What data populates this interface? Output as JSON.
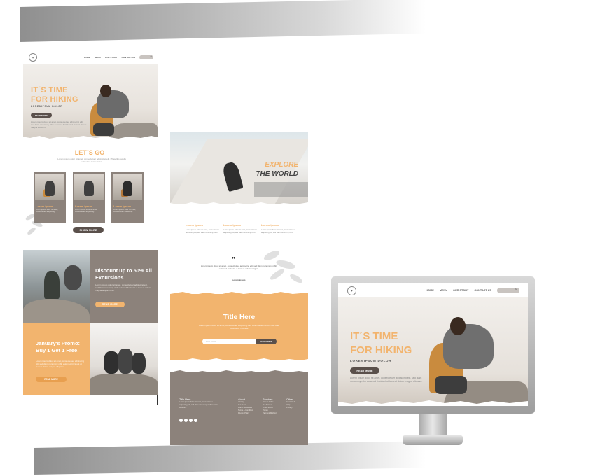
{
  "colors": {
    "accent": "#f2b46e",
    "taupe": "#8c827b",
    "dark": "#5a504b"
  },
  "nav": {
    "home": "HOME",
    "menu": "MENU",
    "story": "OUR STORY",
    "contact": "CONTACT US",
    "logo": "✦"
  },
  "hero": {
    "title_line1": "IT´S TIME",
    "title_line2": "FOR HIKING",
    "subtitle": "LOREMIPSUM DOLOR",
    "button": "READ MORE",
    "text": "Lorem ipsum dolor sit amet, consectetuer adipiscing elit, sed diam nonummy nibh euismod tincidunt ut laoreet dolore magna aliquam."
  },
  "lets_go": {
    "title": "LET´S GO",
    "desc": "Lorem ipsum dolor sit amet, consectetuer adipiscing elit. Phasellus iaculis velit vitae consectetur."
  },
  "cards": [
    {
      "title": "Lorem ipsum",
      "text": "Lorem ipsum dolor sit amet, consectetuer adipiscing."
    },
    {
      "title": "Lorem ipsum",
      "text": "Lorem ipsum dolor sit amet, consectetuer adipiscing."
    },
    {
      "title": "Lorem ipsum",
      "text": "Lorem ipsum dolor sit amet, consectetuer adipiscing."
    }
  ],
  "show_more": "SHOW MORE",
  "discount": {
    "title": "Discount up to 50% All Excursions",
    "text": "Lorem ipsum dolor sit amet, consectetuer adipiscing elit, sed diam nonummy nibh euismod tincidunt ut laoreet dolore magna aliquam erat.",
    "button": "READ MORE"
  },
  "promo": {
    "title": "January's Promo: Buy 1 Get 1 Free!",
    "text": "Lorem ipsum dolor sit amet, consectetuer adipiscing elit, sed diam nonummy nibh euismod tincidunt ut laoreet dolore magna aliquam.",
    "button": "READ MORE"
  },
  "explore": {
    "line1": "EXPLORE",
    "line2": "THE WORLD"
  },
  "columns": [
    {
      "title": "Lorem Ipsum",
      "text": "Lorem ipsum dolor sit amet, consectetuer adipiscing elit, sed diam nonummy nibh."
    },
    {
      "title": "Lorem Ipsum",
      "text": "Lorem ipsum dolor sit amet, consectetuer adipiscing elit, sed diam nonummy nibh."
    },
    {
      "title": "Lorem Ipsum",
      "text": "Lorem ipsum dolor sit amet, consectetuer adipiscing elit, sed diam nonummy nibh."
    }
  ],
  "quote": {
    "mark": "”",
    "text": "Lorem ipsum dolor sit amet, consectetuer adipiscing elit, sed diam nonummy nibh euismod tincidunt ut laoreet dolore magna.",
    "author": "Lorem ipsum"
  },
  "newsletter": {
    "title": "Title Here",
    "text": "Lorem ipsum dolor sit amet, consectetuer adipiscing elit. Vivamus fermentum nisi vitae vestibulum molestie.",
    "email_placeholder": "Your Email",
    "button": "SUBSCRIBE"
  },
  "footer": {
    "col1_title": "Title Here",
    "col1_text": "Lorem ipsum dolor sit amet, consectetuer adipiscing elit, sed diam nonummy nibh euismod tincidunt.",
    "about": {
      "title": "About",
      "links": [
        "History",
        "Our Team",
        "Brand Guidelines",
        "Terms & Condition",
        "Privacy Policy"
      ]
    },
    "services": {
      "title": "Services",
      "links": [
        "How to Order",
        "Our Product",
        "Order Status",
        "Promo",
        "Payment Method"
      ]
    },
    "other": {
      "title": "Other",
      "links": [
        "Contact Us",
        "Help",
        "Privacy"
      ]
    }
  }
}
